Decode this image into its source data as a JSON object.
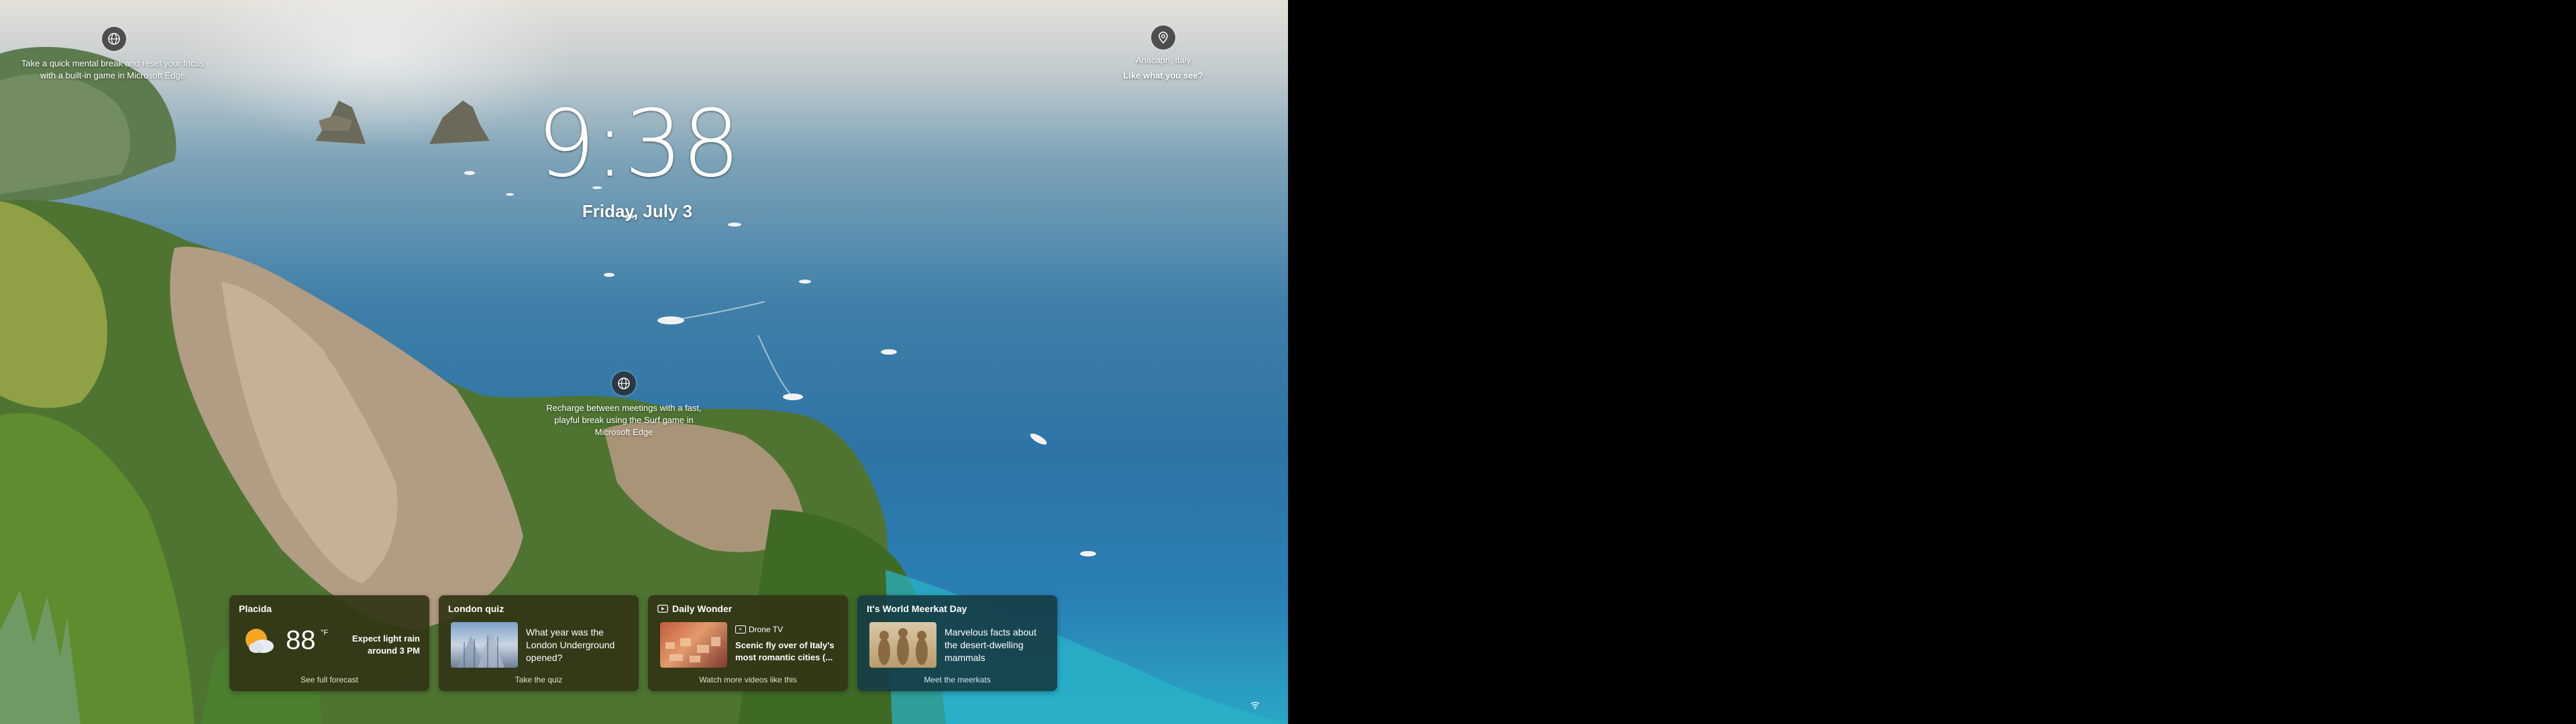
{
  "hotspot_top": {
    "text": "Take a quick mental break and reset your focus with a built-in game in Microsoft Edge",
    "icon": "globe-icon"
  },
  "hotspot_middle": {
    "text": "Recharge between meetings with a fast, playful break using the Surf game in Microsoft Edge",
    "icon": "globe-icon"
  },
  "location": {
    "icon": "location-pin-icon",
    "place": "Anacapri, Italy",
    "prompt": "Like what you see?"
  },
  "clock": {
    "time": "9:38",
    "date": "Friday, July 3"
  },
  "widgets": {
    "weather": {
      "title": "Placida",
      "temperature": "88",
      "unit": "°F",
      "forecast": "Expect light rain around 3 PM",
      "link": "See full forecast",
      "icon": "partly-cloudy-icon"
    },
    "quiz": {
      "title": "London quiz",
      "question": "What year was the London Underground opened?",
      "link": "Take the quiz"
    },
    "wonder": {
      "title": "Daily Wonder",
      "source": "Drone TV",
      "headline": "Scenic fly over of Italy's most romantic cities (...",
      "link": "Watch more videos like this"
    },
    "meerkat": {
      "title": "It's World Meerkat Day",
      "body": "Marvelous facts about the desert-dwelling mammals",
      "link": "Meet the meerkats"
    }
  },
  "colors": {
    "card_olive": "#323416",
    "card_teal": "#163e46",
    "sea": "#2e74a6"
  }
}
